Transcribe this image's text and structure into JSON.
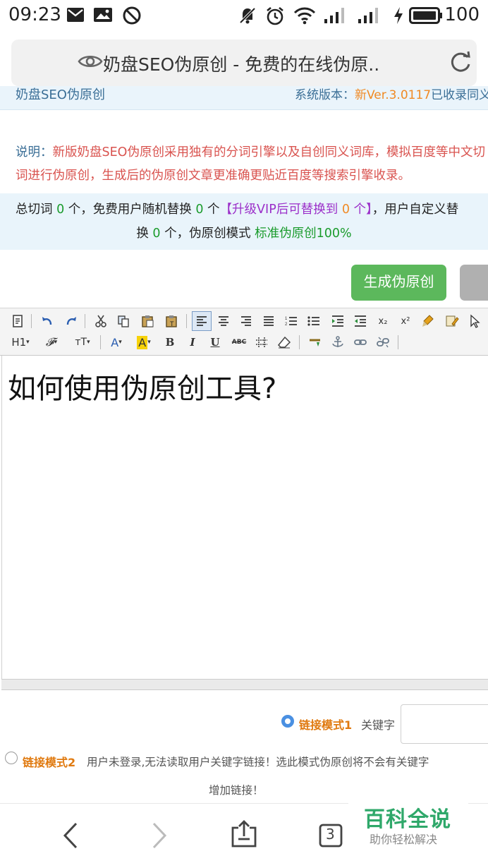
{
  "status_bar": {
    "time": "09:23",
    "battery": "100"
  },
  "address_bar": {
    "title": "奶盘SEO伪原创 - 免费的在线伪原.."
  },
  "site_header": {
    "brand": "奶盘SEO伪原创",
    "version_label": "系统版本：",
    "version_value": "新Ver.3.0117",
    "version_tail": "已收录同义"
  },
  "description": {
    "label": "说明：",
    "text": "新版奶盘SEO伪原创采用独有的分词引擎以及自创同义词库，模拟百度等中文切词进行伪原创，生成后的伪原创文章更准确更贴近百度等搜索引擎收录。"
  },
  "stats": {
    "t1": "总切词 ",
    "n1": "0",
    "t2": " 个，免费用户随机替换 ",
    "n2": "0",
    "t3": " 个",
    "vip_a": "【升级VIP后可替换到 ",
    "n3": "0",
    "vip_b": " 个】",
    "t4": "，用户自定义替",
    "t5": "换 ",
    "n4": "0",
    "t6": " 个，伪原创模式 ",
    "mode": "标准伪原创100%"
  },
  "actions": {
    "generate_label": "生成伪原创"
  },
  "editor": {
    "content": "如何使用伪原创工具?",
    "heading_label": "H1",
    "font_label": "𝓕",
    "size_label": "тT",
    "color_label": "A",
    "bg_label": "A",
    "bold": "B",
    "italic": "I",
    "underline": "U",
    "strike": "ABC",
    "sub": "x₂",
    "sup": "x²"
  },
  "link_modes": {
    "mode1_label": "链接模式1",
    "keyword_label": "关键字",
    "mode2_label": "链接模式2",
    "mode2_note_a": "用户未登录,无法读取用户关键字链接！选此模式伪原创将不会有关键字",
    "mode2_note_b": "增加链接！",
    "selected": "mode1"
  },
  "bottom_nav": {
    "tab_count": "3"
  },
  "watermark": {
    "big": "百科全说",
    "small": "助你轻松解决"
  },
  "colors": {
    "accent_green": "#5cb85c",
    "desc_red": "#d9534f",
    "orange": "#f08a24",
    "purple": "#9b2fc9"
  }
}
